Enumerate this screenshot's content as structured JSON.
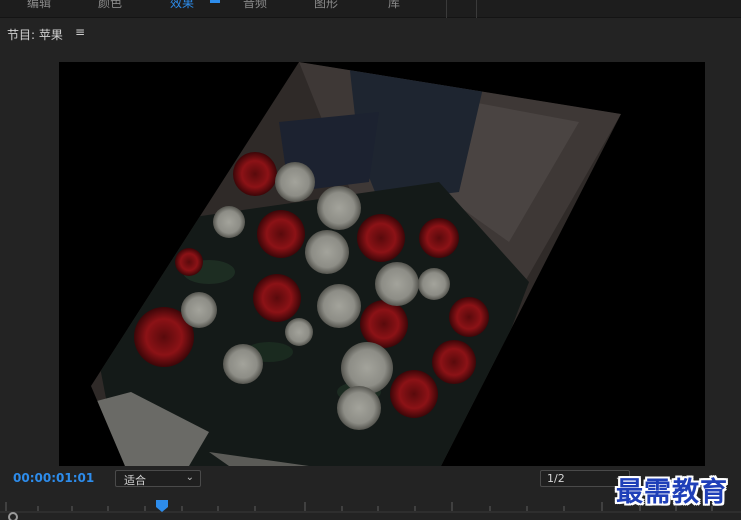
{
  "workspace_tabs": [
    {
      "label": "编辑",
      "active": false
    },
    {
      "label": "颜色",
      "active": false
    },
    {
      "label": "效果",
      "active": true
    },
    {
      "label": "音频",
      "active": false
    },
    {
      "label": "图形",
      "active": false
    },
    {
      "label": "库",
      "active": false
    }
  ],
  "panel": {
    "title": "节目: 苹果",
    "menu_icon": "≡"
  },
  "controls": {
    "timecode": "00:00:01:01",
    "fit_label": "适合",
    "resolution": "1/2"
  },
  "colors": {
    "accent": "#2d8ceb",
    "panel_bg": "#232323",
    "viewer_bg": "#000000"
  },
  "watermark": "最需教育"
}
